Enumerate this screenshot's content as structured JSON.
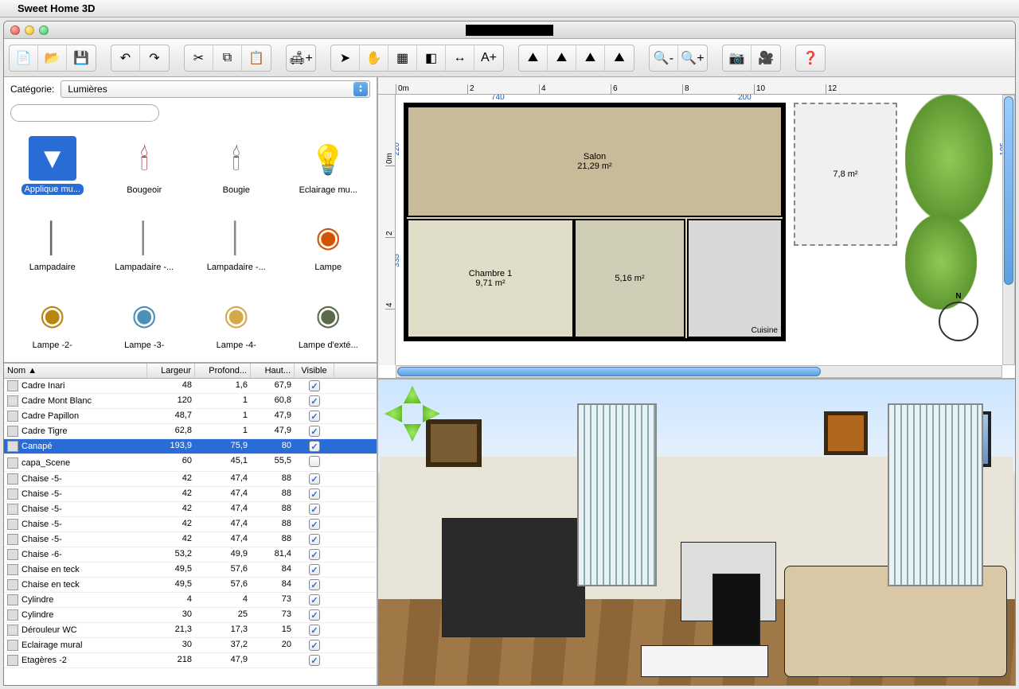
{
  "menubar": {
    "app_name": "Sweet Home 3D"
  },
  "window_title": "",
  "toolbar": {
    "groups": [
      {
        "buttons": [
          {
            "name": "new-file-button",
            "glyph": "📄"
          },
          {
            "name": "open-file-button",
            "glyph": "📂"
          },
          {
            "name": "save-file-button",
            "glyph": "💾"
          }
        ]
      },
      {
        "buttons": [
          {
            "name": "undo-button",
            "glyph": "↶"
          },
          {
            "name": "redo-button",
            "glyph": "↷"
          }
        ]
      },
      {
        "buttons": [
          {
            "name": "cut-button",
            "glyph": "✂"
          },
          {
            "name": "copy-button",
            "glyph": "⧉"
          },
          {
            "name": "paste-button",
            "glyph": "📋"
          }
        ]
      },
      {
        "buttons": [
          {
            "name": "add-furniture-button",
            "glyph": "🛋+"
          }
        ]
      },
      {
        "buttons": [
          {
            "name": "select-tool-button",
            "glyph": "➤"
          },
          {
            "name": "pan-tool-button",
            "glyph": "✋"
          },
          {
            "name": "wall-tool-button",
            "glyph": "▦"
          },
          {
            "name": "room-tool-button",
            "glyph": "◧"
          },
          {
            "name": "dimension-tool-button",
            "glyph": "↔"
          },
          {
            "name": "text-tool-button",
            "glyph": "A+"
          }
        ]
      },
      {
        "buttons": [
          {
            "name": "plan-3d-button",
            "glyph": "⛰"
          },
          {
            "name": "view-north-button",
            "glyph": "⛰"
          },
          {
            "name": "view-top-button",
            "glyph": "⛰"
          },
          {
            "name": "view-aerial-button",
            "glyph": "⛰"
          }
        ]
      },
      {
        "buttons": [
          {
            "name": "zoom-out-button",
            "glyph": "🔍-"
          },
          {
            "name": "zoom-in-button",
            "glyph": "🔍+"
          }
        ]
      },
      {
        "buttons": [
          {
            "name": "photo-button",
            "glyph": "📷"
          },
          {
            "name": "video-button",
            "glyph": "🎥"
          }
        ]
      },
      {
        "buttons": [
          {
            "name": "help-button",
            "glyph": "❓"
          }
        ]
      }
    ]
  },
  "catalog": {
    "category_label": "Catégorie:",
    "selected_category": "Lumières",
    "search_placeholder": "",
    "search_value": "",
    "items": [
      {
        "name": "Applique mu...",
        "glyph": "▼",
        "selected": true,
        "color": "#fff"
      },
      {
        "name": "Bougeoir",
        "glyph": "🕯",
        "selected": false,
        "color": "#8b0000"
      },
      {
        "name": "Bougie",
        "glyph": "🕯",
        "selected": false,
        "color": "#333"
      },
      {
        "name": "Eclairage mu...",
        "glyph": "💡",
        "selected": false,
        "color": "#222"
      },
      {
        "name": "Lampadaire",
        "glyph": "│",
        "selected": false,
        "color": "#666"
      },
      {
        "name": "Lampadaire -...",
        "glyph": "│",
        "selected": false,
        "color": "#888"
      },
      {
        "name": "Lampadaire -...",
        "glyph": "│",
        "selected": false,
        "color": "#888"
      },
      {
        "name": "Lampe",
        "glyph": "◉",
        "selected": false,
        "color": "#d35400"
      },
      {
        "name": "Lampe -2-",
        "glyph": "◉",
        "selected": false,
        "color": "#b8860b"
      },
      {
        "name": "Lampe -3-",
        "glyph": "◉",
        "selected": false,
        "color": "#4a90b8"
      },
      {
        "name": "Lampe -4-",
        "glyph": "◉",
        "selected": false,
        "color": "#d4a94a"
      },
      {
        "name": "Lampe d'exté...",
        "glyph": "◉",
        "selected": false,
        "color": "#5a6a4a"
      }
    ]
  },
  "furniture_table": {
    "columns": {
      "name": "Nom ▲",
      "width": "Largeur",
      "depth": "Profond...",
      "height": "Haut...",
      "visible": "Visible"
    },
    "rows": [
      {
        "name": "Cadre Inari",
        "w": "48",
        "d": "1,6",
        "h": "67,9",
        "visible": true,
        "selected": false
      },
      {
        "name": "Cadre Mont Blanc",
        "w": "120",
        "d": "1",
        "h": "60,8",
        "visible": true,
        "selected": false
      },
      {
        "name": "Cadre Papillon",
        "w": "48,7",
        "d": "1",
        "h": "47,9",
        "visible": true,
        "selected": false
      },
      {
        "name": "Cadre Tigre",
        "w": "62,8",
        "d": "1",
        "h": "47,9",
        "visible": true,
        "selected": false
      },
      {
        "name": "Canapé",
        "w": "193,9",
        "d": "75,9",
        "h": "80",
        "visible": true,
        "selected": true
      },
      {
        "name": "capa_Scene",
        "w": "60",
        "d": "45,1",
        "h": "55,5",
        "visible": false,
        "selected": false
      },
      {
        "name": "Chaise -5-",
        "w": "42",
        "d": "47,4",
        "h": "88",
        "visible": true,
        "selected": false
      },
      {
        "name": "Chaise -5-",
        "w": "42",
        "d": "47,4",
        "h": "88",
        "visible": true,
        "selected": false
      },
      {
        "name": "Chaise -5-",
        "w": "42",
        "d": "47,4",
        "h": "88",
        "visible": true,
        "selected": false
      },
      {
        "name": "Chaise -5-",
        "w": "42",
        "d": "47,4",
        "h": "88",
        "visible": true,
        "selected": false
      },
      {
        "name": "Chaise -5-",
        "w": "42",
        "d": "47,4",
        "h": "88",
        "visible": true,
        "selected": false
      },
      {
        "name": "Chaise -6-",
        "w": "53,2",
        "d": "49,9",
        "h": "81,4",
        "visible": true,
        "selected": false
      },
      {
        "name": "Chaise en teck",
        "w": "49,5",
        "d": "57,6",
        "h": "84",
        "visible": true,
        "selected": false
      },
      {
        "name": "Chaise en teck",
        "w": "49,5",
        "d": "57,6",
        "h": "84",
        "visible": true,
        "selected": false
      },
      {
        "name": "Cylindre",
        "w": "4",
        "d": "4",
        "h": "73",
        "visible": true,
        "selected": false
      },
      {
        "name": "Cylindre",
        "w": "30",
        "d": "25",
        "h": "73",
        "visible": true,
        "selected": false
      },
      {
        "name": "Dérouleur WC",
        "w": "21,3",
        "d": "17,3",
        "h": "15",
        "visible": true,
        "selected": false
      },
      {
        "name": "Eclairage mural",
        "w": "30",
        "d": "37,2",
        "h": "20",
        "visible": true,
        "selected": false
      },
      {
        "name": "Etagères -2",
        "w": "218",
        "d": "47,9",
        "h": "",
        "visible": true,
        "selected": false
      }
    ]
  },
  "plan": {
    "ruler_h": [
      "0m",
      "2",
      "4",
      "6",
      "8",
      "10",
      "12"
    ],
    "ruler_v": [
      "0m",
      "2",
      "4"
    ],
    "dimensions": {
      "w1": "740",
      "w2": "200",
      "h1": "220",
      "h2": "335",
      "h3": "185"
    },
    "rooms": {
      "salon": {
        "name": "Salon",
        "area": "21,29 m²"
      },
      "chambre": {
        "name": "Chambre 1",
        "area": "9,71 m²"
      },
      "bath": {
        "name": "",
        "area": "5,16 m²"
      },
      "cuisine": {
        "name": "Cuisine",
        "area": ""
      },
      "terrace": {
        "name": "",
        "area": "7,8 m²"
      }
    },
    "compass_label": "N"
  },
  "view3d": {
    "nav_visible": true
  }
}
